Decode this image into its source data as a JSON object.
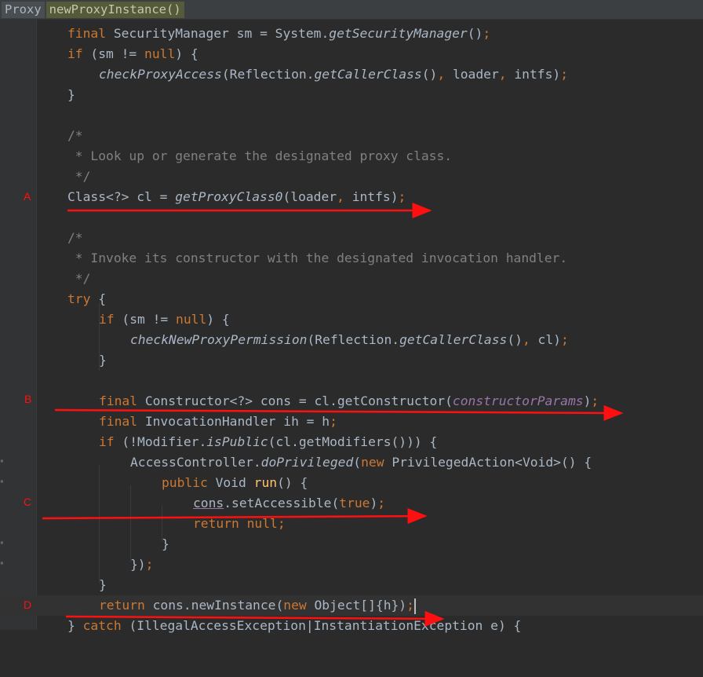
{
  "breadcrumbs": [
    "Proxy",
    "newProxyInstance()"
  ],
  "markers": [
    "A",
    "B",
    "C",
    "D"
  ],
  "code_lines": [
    "final SecurityManager sm = System.getSecurityManager();",
    "if (sm != null) {",
    "checkProxyAccess(Reflection.getCallerClass(), loader, intfs);",
    "}",
    "",
    "/*",
    " * Look up or generate the designated proxy class.",
    " */",
    "Class<?> cl = getProxyClass0(loader, intfs);",
    "",
    "/*",
    " * Invoke its constructor with the designated invocation handler.",
    " */",
    "try {",
    "if (sm != null) {",
    "checkNewProxyPermission(Reflection.getCallerClass(), cl);",
    "}",
    "",
    "final Constructor<?> cons = cl.getConstructor(constructorParams);",
    "final InvocationHandler ih = h;",
    "if (!Modifier.isPublic(cl.getModifiers())) {",
    "AccessController.doPrivileged(new PrivilegedAction<Void>() {",
    "public Void run() {",
    "cons.setAccessible(true);",
    "return null;",
    "}",
    "});",
    "}",
    "return cons.newInstance(new Object[]{h});",
    "} catch (IllegalAccessException|InstantiationException e) {"
  ],
  "colors": {
    "background": "#2b2b2b",
    "keyword": "#cc7832",
    "text": "#a9b7c6",
    "comment": "#808080",
    "field": "#9876aa",
    "annotation": "#ff1010"
  }
}
